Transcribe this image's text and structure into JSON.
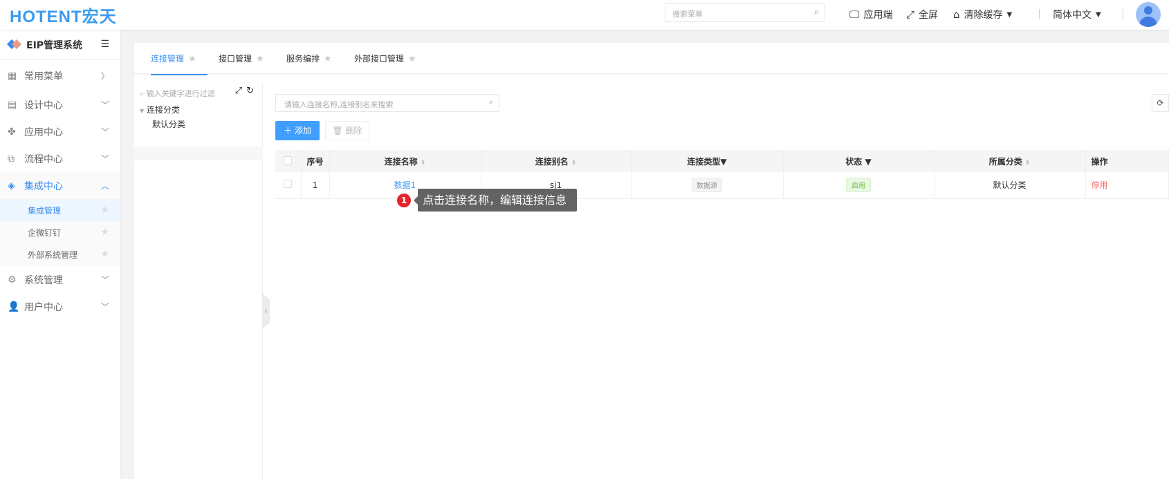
{
  "header": {
    "logo": "HOTENT宏天",
    "search_placeholder": "搜索菜单",
    "app_client": "应用端",
    "fullscreen": "全屏",
    "clear_cache": "清除缓存",
    "language": "简体中文"
  },
  "sidebar": {
    "system_title": "EIP管理系统",
    "items": [
      {
        "label": "常用菜单",
        "icon": "grid-icon"
      },
      {
        "label": "设计中心",
        "icon": "design-icon"
      },
      {
        "label": "应用中心",
        "icon": "apps-icon"
      },
      {
        "label": "流程中心",
        "icon": "flow-icon"
      },
      {
        "label": "集成中心",
        "icon": "layers-icon"
      },
      {
        "label": "系统管理",
        "icon": "gear-icon"
      },
      {
        "label": "用户中心",
        "icon": "user-icon"
      }
    ],
    "sub_items": [
      {
        "label": "集成管理"
      },
      {
        "label": "企微钉钉"
      },
      {
        "label": "外部系统管理"
      }
    ]
  },
  "tabs": [
    {
      "label": "连接管理"
    },
    {
      "label": "接口管理"
    },
    {
      "label": "服务编排"
    },
    {
      "label": "外部接口管理"
    }
  ],
  "tree": {
    "filter_placeholder": "输入关键字进行过滤",
    "root": "连接分类",
    "child": "默认分类"
  },
  "toolbar": {
    "search_placeholder": "请输入连接名称,连接别名来搜索",
    "add_label": "添加",
    "delete_label": "删除"
  },
  "table": {
    "columns": [
      "序号",
      "连接名称",
      "连接别名",
      "连接类型",
      "状态",
      "所属分类",
      "操作"
    ],
    "rows": [
      {
        "index": "1",
        "name": "数据1",
        "alias": "sj1",
        "type": "数据源",
        "status": "启用",
        "category": "默认分类",
        "action": "停用"
      }
    ]
  },
  "tooltip": {
    "step": "1",
    "text": "点击连接名称，编辑连接信息"
  }
}
